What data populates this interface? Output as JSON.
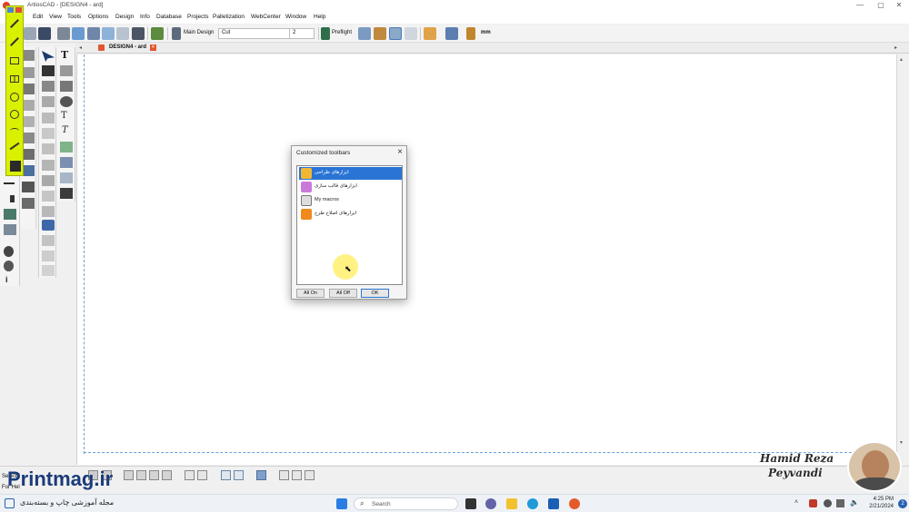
{
  "app": {
    "title": "ArtiosCAD - [DESIGN4 - ard]",
    "controls": {
      "minimize": "—",
      "maximize": "▢",
      "close": "✕"
    }
  },
  "menubar": {
    "items": [
      "Edit",
      "View",
      "Tools",
      "Options",
      "Design",
      "Info",
      "Database",
      "Projects",
      "Palletization",
      "WebCenter",
      "Window",
      "Help"
    ]
  },
  "toolbar": {
    "main_design_label": "Main Design",
    "cut_value": "Cut",
    "pointage_value": "2",
    "preflight_label": "Preflight",
    "units_label": "mm"
  },
  "document_tab": {
    "label": "DESIGN4 - ard"
  },
  "dialog": {
    "title": "Customized toolbars",
    "items": [
      {
        "label": "ابزارهای طراحی",
        "selected": true,
        "color": "#f2b632"
      },
      {
        "label": "ابزارهای قالب سازی",
        "selected": false,
        "color": "#c97ad9"
      },
      {
        "label": "My macros",
        "selected": false,
        "color": "#555555"
      },
      {
        "label": "ابزارهای اصلاح طرح",
        "selected": false,
        "color": "#f08a1c"
      }
    ],
    "buttons": {
      "all_on": "All On",
      "all_off": "All Off",
      "ok": "OK"
    }
  },
  "status": {
    "select_text": "Select t",
    "help_text": "For Hel"
  },
  "overlay": {
    "presenter_first": "Hamid Reza",
    "presenter_last": "Peyvandi",
    "logo_text": "Printmag.ir",
    "logo_caption": "مجله آموزشی چاپ و بسته‌بندی"
  },
  "taskbar": {
    "search_placeholder": "Search",
    "time": "4:25 PM",
    "date": "2/21/2024",
    "notification_count": "2"
  },
  "colors": {
    "highlight_toolbar": "#d9f000",
    "selection_blue": "#2a74d6",
    "guide_blue": "#6aa0d8"
  }
}
